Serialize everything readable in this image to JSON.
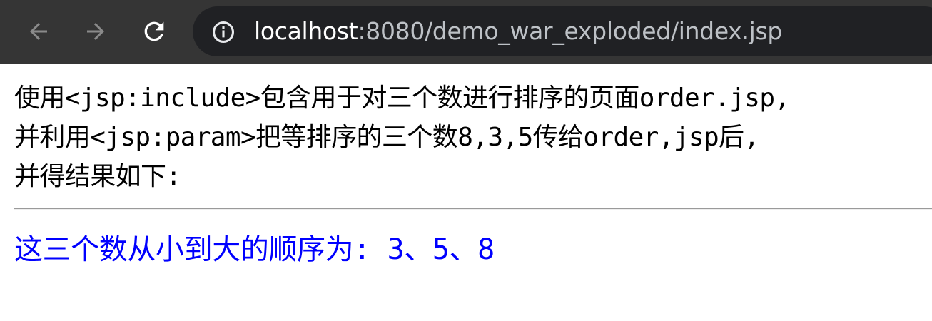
{
  "browser": {
    "url_host": "localhost",
    "url_rest": ":8080/demo_war_exploded/index.jsp",
    "icons": {
      "back": "arrow-left-icon",
      "forward": "arrow-right-icon",
      "reload": "reload-icon",
      "info": "info-icon"
    },
    "colors": {
      "toolbar": "#353535",
      "omnibox": "#202124"
    }
  },
  "page": {
    "intro_lines": [
      "使用<jsp:include>包含用于对三个数进行排序的页面order.jsp,",
      "并利用<jsp:param>把等排序的三个数8,3,5传给order,jsp后,",
      "并得结果如下:"
    ],
    "result": "这三个数从小到大的顺序为: 3、5、8",
    "colors": {
      "result_text": "#0000ff"
    }
  }
}
